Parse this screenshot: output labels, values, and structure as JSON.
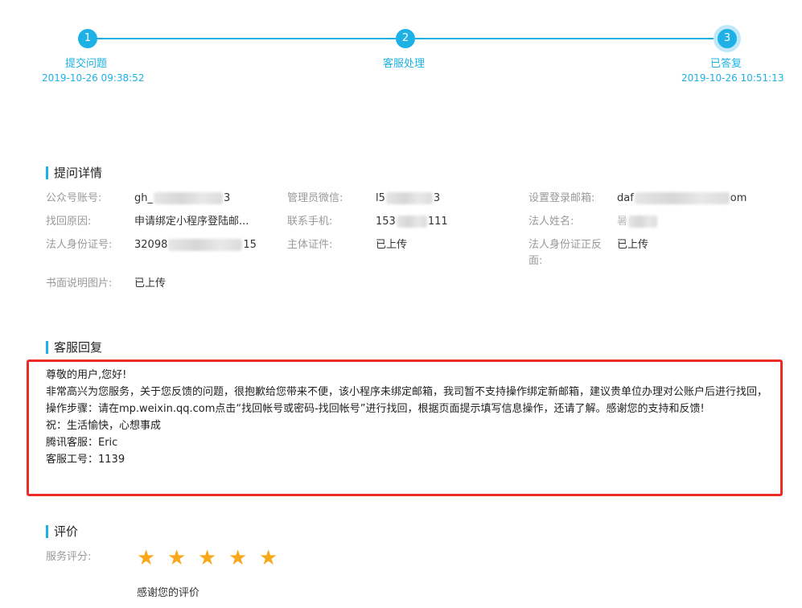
{
  "progress": {
    "steps": [
      {
        "number": "1",
        "label": "提交问题",
        "time": "2019-10-26 09:38:52"
      },
      {
        "number": "2",
        "label": "客服处理",
        "time": ""
      },
      {
        "number": "3",
        "label": "已答复",
        "time": "2019-10-26 10:51:13"
      }
    ],
    "accent_color": "#1eb1e6"
  },
  "details": {
    "title": "提问详情",
    "fields": {
      "account_label": "公众号账号:",
      "account_prefix": "gh_",
      "account_suffix": "3",
      "admin_wechat_label": "管理员微信:",
      "admin_wechat_prefix": "l5",
      "admin_wechat_suffix": "3",
      "email_label": "设置登录邮箱:",
      "email_prefix": "daf",
      "email_suffix": "om",
      "reason_label": "找回原因:",
      "reason_value": "申请绑定小程序登陆邮...",
      "phone_label": "联系手机:",
      "phone_prefix": "153",
      "phone_suffix": "111",
      "legal_name_label": "法人姓名:",
      "legal_name_prefix": "暑",
      "legal_id_label": "法人身份证号:",
      "legal_id_prefix": "32098",
      "legal_id_suffix": "15",
      "entity_cert_label": "主体证件:",
      "entity_cert_value": "已上传",
      "id_both_sides_label": "法人身份证正反面:",
      "id_both_sides_value": "已上传",
      "written_statement_label": "书面说明图片:",
      "written_statement_value": "已上传"
    }
  },
  "reply": {
    "title": "客服回复",
    "lines": [
      "尊敬的用户,您好!",
      "非常高兴为您服务，关于您反馈的问题，很抱歉给您带来不便，该小程序未绑定邮箱，我司暂不支持操作绑定新邮箱，建议贵单位办理对公账户后进行找回，操作步骤：请在mp.weixin.qq.com点击“找回帐号或密码-找回帐号”进行找回，根据页面提示填写信息操作，还请了解。感谢您的支持和反馈!",
      "祝：生活愉快，心想事成",
      "腾讯客服：Eric",
      "客服工号：1139"
    ],
    "highlight_color": "#ee2a24"
  },
  "rating": {
    "title": "评价",
    "score_label": "服务评分:",
    "stars": 5,
    "max_stars": 5,
    "star_color": "#f7a81b",
    "thanks": "感谢您的评价"
  }
}
